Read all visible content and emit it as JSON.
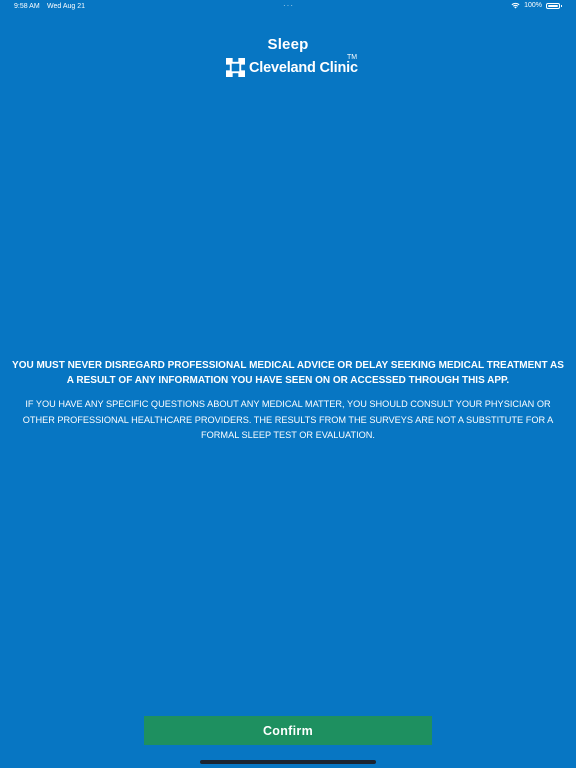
{
  "status_bar": {
    "time": "9:58 AM",
    "date": "Wed Aug 21",
    "battery_text": "100%",
    "icons": [
      "wifi-icon",
      "battery-icon"
    ]
  },
  "header": {
    "title": "Sleep",
    "brand_name": "Cleveland Clinic",
    "trademark": "TM",
    "logo_icon": "cleveland-clinic-logo"
  },
  "disclaimer": {
    "warning": "YOU MUST NEVER DISREGARD PROFESSIONAL MEDICAL ADVICE OR DELAY SEEKING MEDICAL TREATMENT AS A RESULT OF ANY INFORMATION YOU HAVE SEEN ON OR ACCESSED THROUGH THIS APP.",
    "body": "IF YOU HAVE ANY SPECIFIC QUESTIONS ABOUT ANY MEDICAL MATTER, YOU SHOULD CONSULT YOUR PHYSICIAN OR OTHER PROFESSIONAL HEALTHCARE PROVIDERS. THE RESULTS FROM THE SURVEYS ARE NOT A SUBSTITUTE FOR A FORMAL SLEEP TEST OR EVALUATION."
  },
  "actions": {
    "confirm_label": "Confirm"
  },
  "colors": {
    "background": "#0776c3",
    "confirm_button": "#1e9060",
    "text": "#ffffff"
  }
}
